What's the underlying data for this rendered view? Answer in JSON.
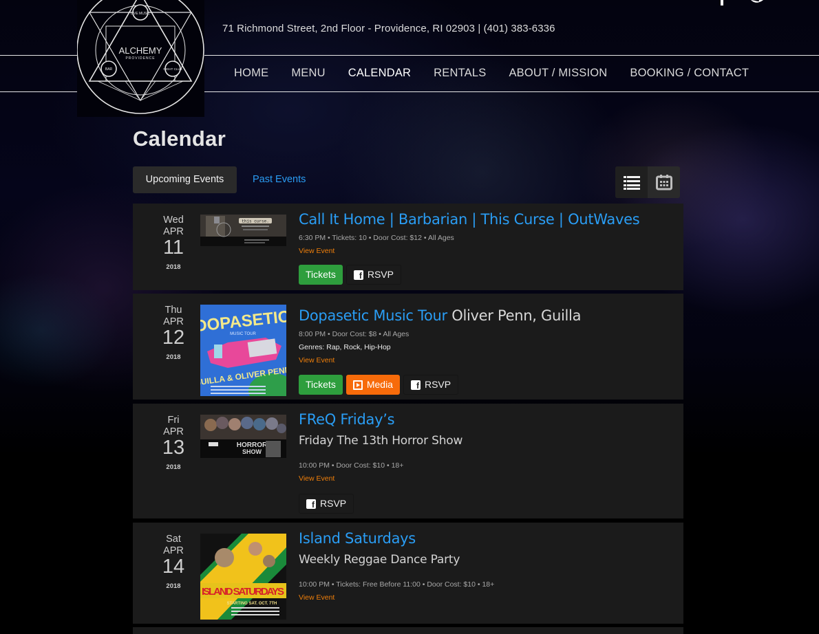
{
  "header": {
    "logo": {
      "name": "ALCHEMY",
      "sub": "PROVIDENCE",
      "badges": [
        "LIVE MUSIC",
        "BAR",
        "NIGHT CLUB"
      ]
    },
    "address": "71 Richmond Street, 2nd Floor - Providence, RI 02903 | (401) 383-6336",
    "social": [
      "facebook-icon",
      "twitter-icon"
    ],
    "nav": [
      {
        "label": "HOME",
        "active": false
      },
      {
        "label": "MENU",
        "active": false
      },
      {
        "label": "CALENDAR",
        "active": true
      },
      {
        "label": "RENTALS",
        "active": false
      },
      {
        "label": "ABOUT / MISSION",
        "active": false
      },
      {
        "label": "BOOKING / CONTACT",
        "active": false
      }
    ]
  },
  "page": {
    "title": "Calendar",
    "tabs": {
      "upcoming": "Upcoming Events",
      "past": "Past Events"
    },
    "view_toggle": [
      "list-view-icon",
      "calendar-view-icon"
    ]
  },
  "colors": {
    "link": "#2a9df4",
    "view_event": "#f07f0a",
    "tickets": "#2e9e3d",
    "media": "#f76b0a",
    "card_bg": "#1b1b1b"
  },
  "events": [
    {
      "dow": "Wed",
      "month": "APR",
      "day": "11",
      "year": "2018",
      "title": "Call It Home | Barbarian | This Curse | OutWaves",
      "title_sub": "",
      "subtitle": "",
      "meta": "6:30 PM • Tickets: 10 • Door Cost: $12 • All Ages",
      "genres": "",
      "view_link": "View Event",
      "buttons": {
        "tickets": "Tickets",
        "rsvp": "RSVP"
      },
      "thumb_alt": "this curse. from the darkest of places"
    },
    {
      "dow": "Thu",
      "month": "APR",
      "day": "12",
      "year": "2018",
      "title": "Dopasetic Music Tour",
      "title_sub": "Oliver Penn, Guilla",
      "subtitle": "",
      "meta": "8:00 PM • Door Cost: $8 • All Ages",
      "genres": "Genres: Rap, Rock, Hip-Hop",
      "view_link": "View Event",
      "buttons": {
        "tickets": "Tickets",
        "media": "Media",
        "rsvp": "RSVP"
      },
      "thumb_alt": "DOPASETIC MUSIC TOUR - GUILLA & OLIVER PENN"
    },
    {
      "dow": "Fri",
      "month": "APR",
      "day": "13",
      "year": "2018",
      "title": "FReQ Friday’s",
      "title_sub": "",
      "subtitle": "Friday The 13th Horror Show",
      "meta": "10:00 PM • Door Cost: $10 • 18+",
      "genres": "",
      "view_link": "View Event",
      "buttons": {
        "rsvp": "RSVP"
      },
      "thumb_alt": "FREQ HORROR SHOW"
    },
    {
      "dow": "Sat",
      "month": "APR",
      "day": "14",
      "year": "2018",
      "title": "Island Saturdays",
      "title_sub": "",
      "subtitle": "Weekly Reggae Dance Party",
      "meta": "10:00 PM • Tickets: Free Before 11:00 • Door Cost: $10 • 18+",
      "genres": "",
      "view_link": "View Event",
      "buttons": {},
      "thumb_alt": "ISLAND SATURDAYS - STARTING SAT. OCT. 7TH"
    }
  ]
}
